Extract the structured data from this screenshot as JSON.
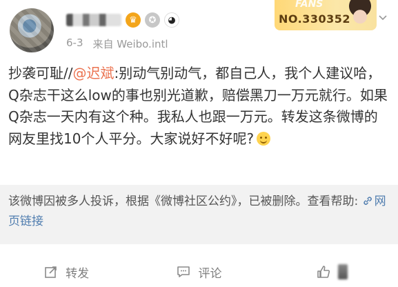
{
  "post": {
    "meta": {
      "date": "6-3",
      "source": "来自 Weibo.intl"
    },
    "fans_card": {
      "label": "FANS",
      "number": "NO.330352"
    },
    "body": {
      "prefix": "抄袭可耻//",
      "mention": "@迟斌",
      "text": ":别动气别动气，都自己人，我个人建议哈，Q杂志干这么low的事也别光道歉，赔偿黑刀一万元就行。如果Q杂志一天内有这个种。我私人也跟一万元。转发这条微博的网友里找10个人平分。大家说好不好呢?"
    },
    "notice": {
      "text": "该微博因被多人投诉，根据《微博社区公约》，已被删除。查看帮助: ",
      "link": "网页链接"
    },
    "actions": {
      "repost": "转发",
      "comment": "评论"
    }
  },
  "colors": {
    "mention": "#eb7350",
    "link": "#507daf",
    "meta": "#999999",
    "notice_bg": "#f2f2f2"
  }
}
